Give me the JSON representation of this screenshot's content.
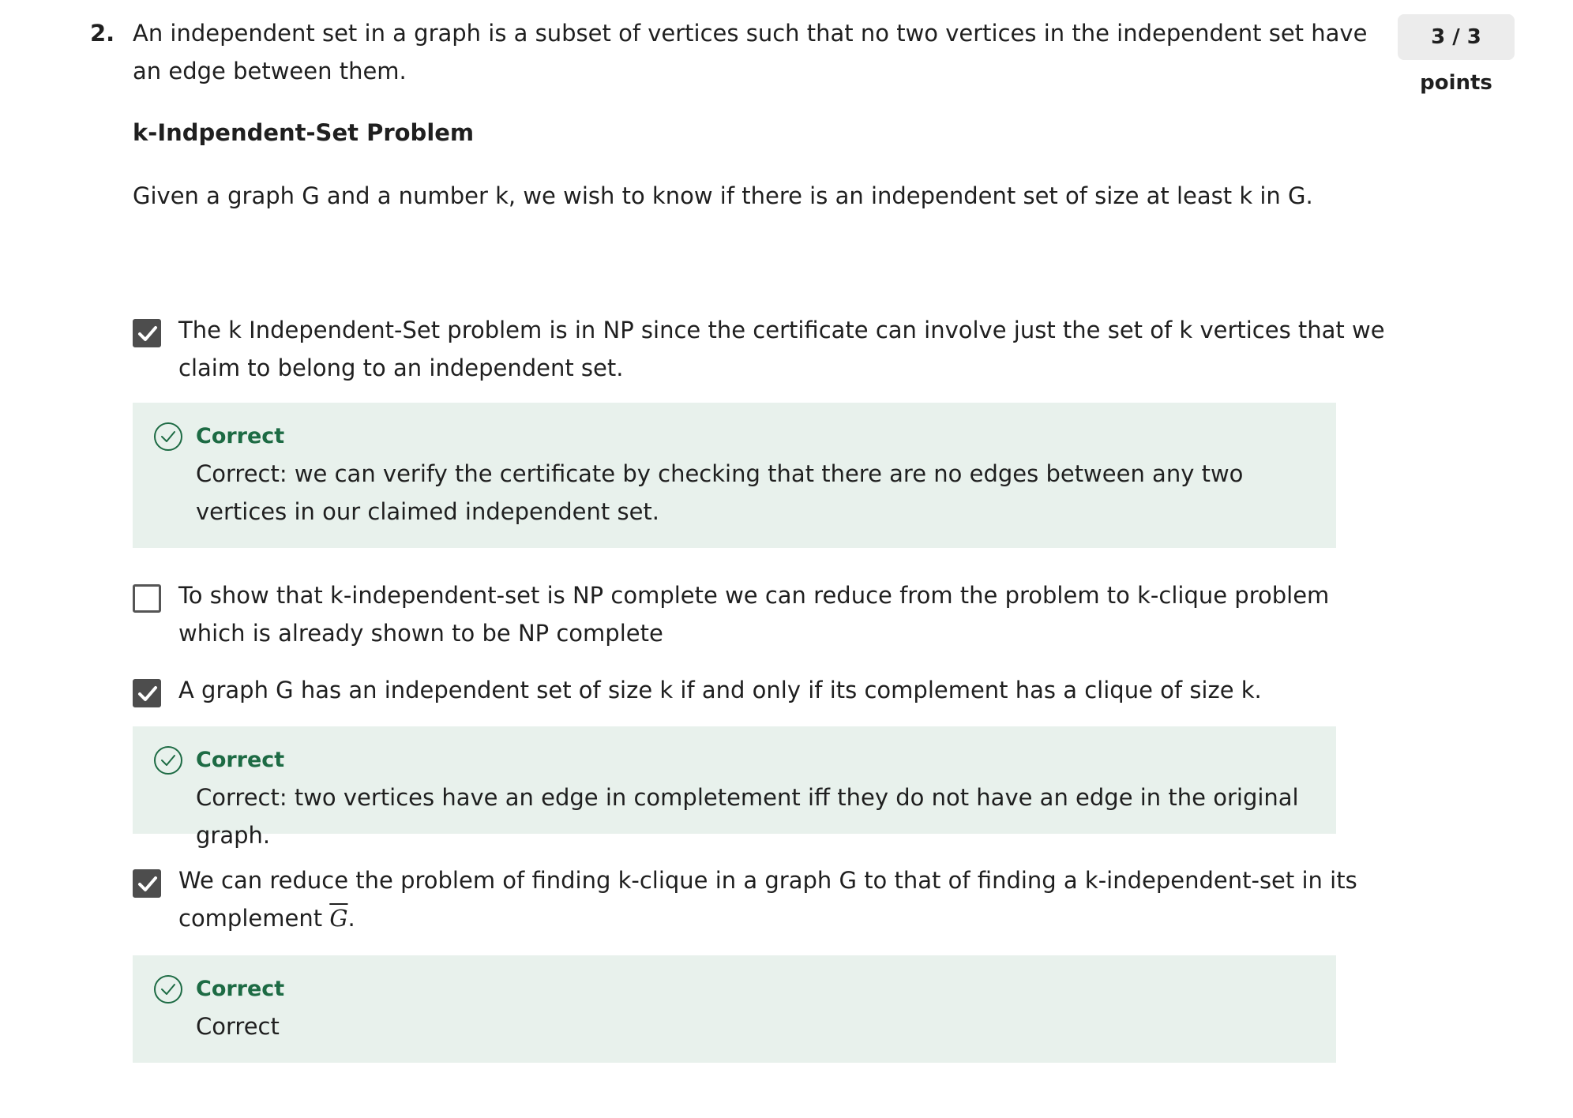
{
  "question": {
    "number": "2.",
    "text": "An independent set in a graph is a subset of vertices such that no two vertices in the independent set have an edge between them.",
    "subtitle": "k-Indpendent-Set Problem",
    "given": "Given a graph G and a number k,  we wish to know if there is an independent set of size at least k in G.",
    "points": "3 / 3 points"
  },
  "options": [
    {
      "text": "The k Independent-Set problem is in NP since the certificate can involve just the set of k vertices that we claim to belong to an independent set.",
      "checked": true,
      "feedback_title": "Correct",
      "feedback_text": "Correct: we can verify the certificate by checking that there are no edges between any two vertices in our claimed independent set."
    },
    {
      "text": "To show that k-independent-set is NP complete we can reduce from the problem to k-clique problem which is already shown to be NP complete",
      "checked": false
    },
    {
      "text": "A graph G has an independent set of size k if and only if its complement has a clique of size k.",
      "checked": true,
      "feedback_title": "Correct",
      "feedback_text": "Correct: two vertices have an edge in completement iff they do not have an edge in the original graph."
    },
    {
      "text": "We can reduce the problem of finding k-clique in a graph G to that of finding a k-independent-set in its complement",
      "text_math": "G",
      "text_end": ".",
      "checked": true,
      "feedback_title": "Correct",
      "feedback_text": "Correct"
    }
  ],
  "colors": {
    "feedback_bg": "#e8f1ec",
    "correct_green": "#1d6b44",
    "checkbox_fill": "#4d4d4d",
    "points_bg": "#ececec"
  },
  "icons": {
    "checkbox_checked": "check-icon",
    "feedback": "circle-check-icon"
  }
}
